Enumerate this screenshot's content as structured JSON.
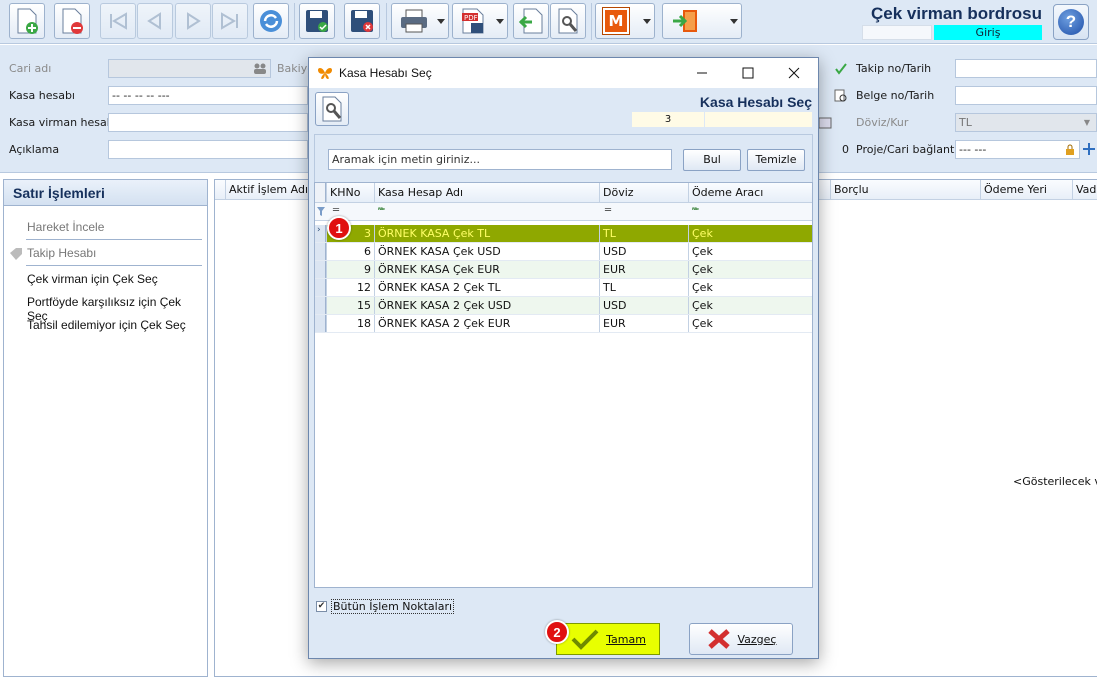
{
  "header": {
    "document_title": "Çek virman bordrosu",
    "mode": "Giriş",
    "help_label": "?"
  },
  "toolbar": {
    "pdf_label": "PDF",
    "m_label": "M"
  },
  "form": {
    "cari_adi_label": "Cari adı",
    "bakiye_label": "Bakiye",
    "kasa_hesabi_label": "Kasa hesabı",
    "kasa_hesabi_value": "-- -- -- -- ---",
    "kasa_virman_label": "Kasa virman hesabı",
    "aciklama_label": "Açıklama",
    "takip_label": "Takip no/Tarih",
    "belge_label": "Belge no/Tarih",
    "doviz_label": "Döviz/Kur",
    "doviz_value": "TL",
    "proje_label": "Proje/Cari bağlantı",
    "proje_value": "--- ---",
    "zero_value": "0"
  },
  "left_panel": {
    "title": "Satır İşlemleri",
    "items": [
      {
        "label": "Hareket İncele",
        "enabled": false
      },
      {
        "label": "Takip Hesabı",
        "enabled": false
      },
      {
        "label": "Çek virman için Çek Seç",
        "enabled": true
      },
      {
        "label": "Portföyde karşılıksız için Çek Seç",
        "enabled": true
      },
      {
        "label": "Tahsil edilemiyor için Çek Seç",
        "enabled": true
      }
    ]
  },
  "main_grid": {
    "columns": [
      "Aktif İşlem Adı",
      "Borçlu",
      "Ödeme Yeri",
      "Vade"
    ],
    "empty_text": "<Gösterilecek ver"
  },
  "modal": {
    "window_title": "Kasa Hesabı Seç",
    "heading": "Kasa Hesabı Seç",
    "record_count": "3",
    "search_placeholder": "Aramak için metin giriniz...",
    "find_button": "Bul",
    "clear_button": "Temizle",
    "columns": [
      "KHNo",
      "Kasa Hesap Adı",
      "Döviz",
      "Ödeme Aracı"
    ],
    "rows": [
      {
        "no": "3",
        "name": "ÖRNEK KASA Çek TL",
        "currency": "TL",
        "method": "Çek",
        "selected": true
      },
      {
        "no": "6",
        "name": "ÖRNEK KASA Çek USD",
        "currency": "USD",
        "method": "Çek",
        "selected": false
      },
      {
        "no": "9",
        "name": "ÖRNEK KASA Çek EUR",
        "currency": "EUR",
        "method": "Çek",
        "selected": false
      },
      {
        "no": "12",
        "name": "ÖRNEK KASA 2 Çek TL",
        "currency": "TL",
        "method": "Çek",
        "selected": false
      },
      {
        "no": "15",
        "name": "ÖRNEK KASA 2 Çek USD",
        "currency": "USD",
        "method": "Çek",
        "selected": false
      },
      {
        "no": "18",
        "name": "ÖRNEK KASA 2 Çek EUR",
        "currency": "EUR",
        "method": "Çek",
        "selected": false
      }
    ],
    "all_points_label": "Bütün İşlem Noktaları",
    "all_points_checked": true,
    "ok_button": "Tamam",
    "cancel_button": "Vazgeç"
  },
  "annotations": {
    "step1": "1",
    "step2": "2"
  },
  "colors": {
    "selected_row": "#8fa800",
    "selected_text": "#ffff66",
    "ok_button": "#e8ff00",
    "badge": "#e01010",
    "mode_badge": "#00ffff",
    "title_text": "#16305c"
  }
}
